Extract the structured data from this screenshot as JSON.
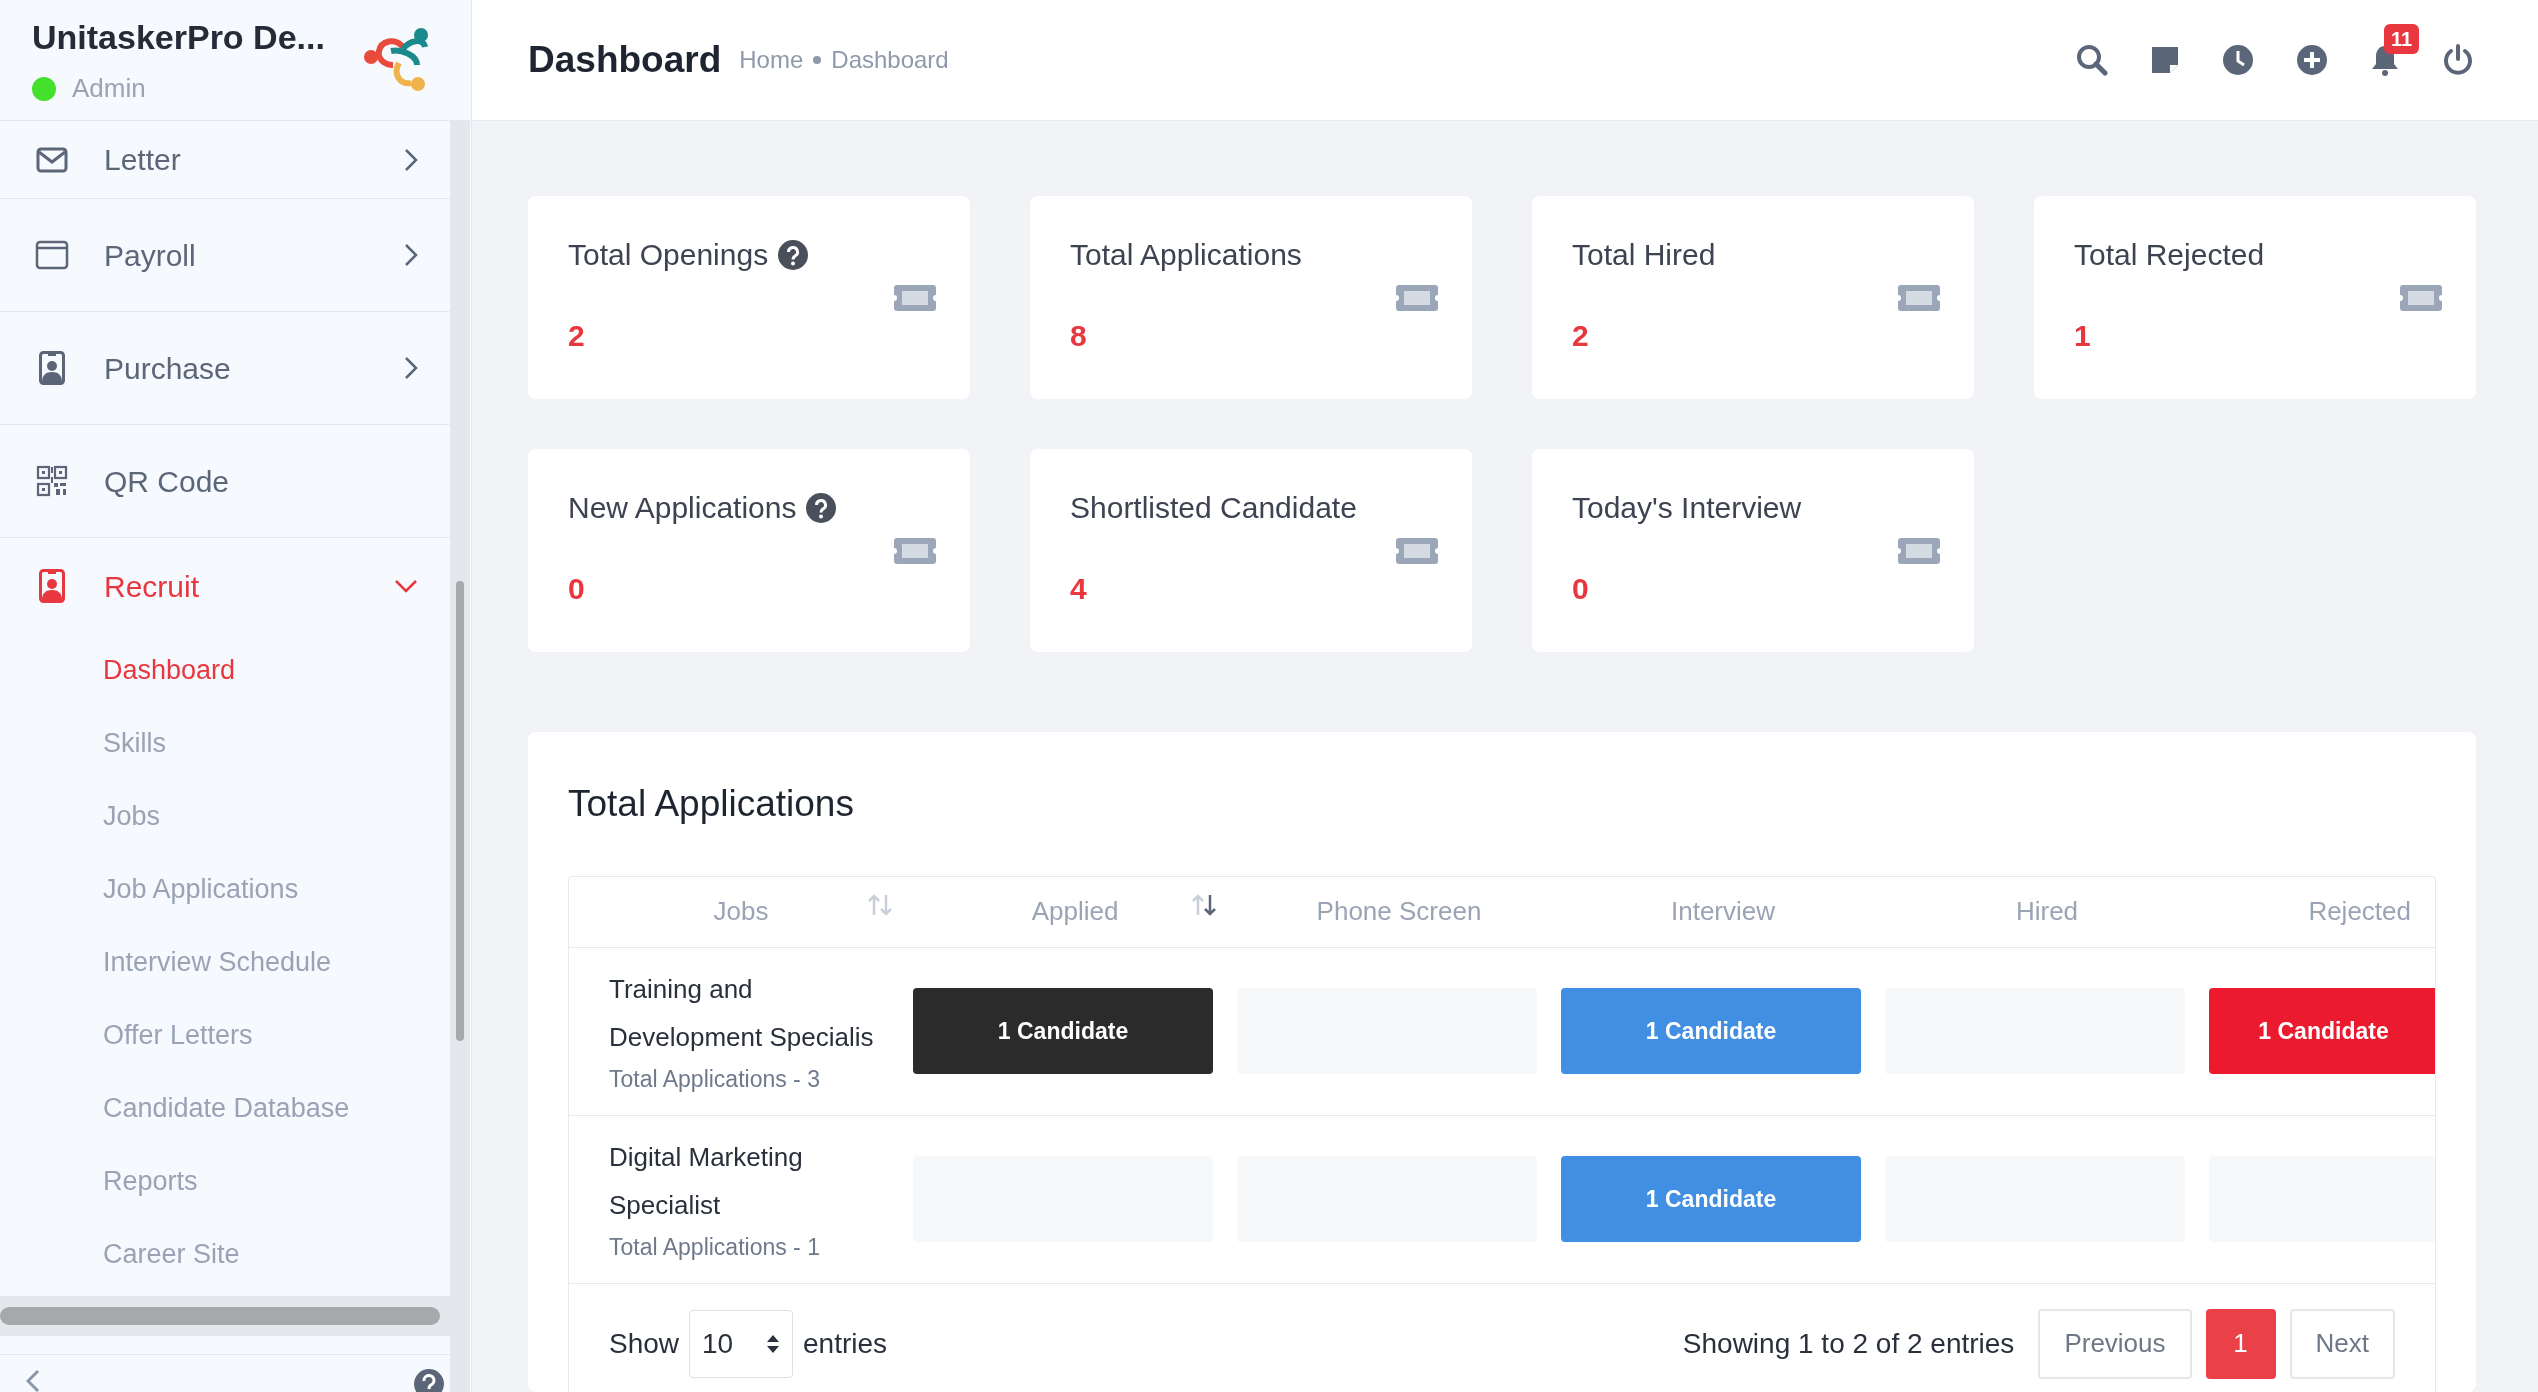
{
  "sidebar": {
    "app_name": "UnitaskerPro De...",
    "role": "Admin",
    "online": true,
    "menu": [
      {
        "label": "Letter",
        "has_arrow": true,
        "expanded": false,
        "selected": false
      },
      {
        "label": "Payroll",
        "has_arrow": true,
        "expanded": false,
        "selected": false
      },
      {
        "label": "Purchase",
        "has_arrow": true,
        "expanded": false,
        "selected": false
      },
      {
        "label": "QR Code",
        "has_arrow": false,
        "selected": false
      },
      {
        "label": "Recruit",
        "has_arrow": true,
        "expanded": true,
        "selected": true,
        "children": [
          {
            "label": "Dashboard",
            "selected": true
          },
          {
            "label": "Skills",
            "selected": false
          },
          {
            "label": "Jobs",
            "selected": false
          },
          {
            "label": "Job Applications",
            "selected": false
          },
          {
            "label": "Interview Schedule",
            "selected": false
          },
          {
            "label": "Offer Letters",
            "selected": false
          },
          {
            "label": "Candidate Database",
            "selected": false
          },
          {
            "label": "Reports",
            "selected": false
          },
          {
            "label": "Career Site",
            "selected": false
          }
        ]
      }
    ]
  },
  "header": {
    "title": "Dashboard",
    "breadcrumb": [
      "Home",
      "Dashboard"
    ],
    "notification_count": "11"
  },
  "stats": [
    {
      "label": "Total Openings",
      "value": "2",
      "help": true
    },
    {
      "label": "Total Applications",
      "value": "8",
      "help": false
    },
    {
      "label": "Total Hired",
      "value": "2",
      "help": false
    },
    {
      "label": "Total Rejected",
      "value": "1",
      "help": false
    },
    {
      "label": "New Applications",
      "value": "0",
      "help": true
    },
    {
      "label": "Shortlisted Candidate",
      "value": "4",
      "help": false
    },
    {
      "label": "Today's Interview",
      "value": "0",
      "help": false
    }
  ],
  "applications": {
    "title": "Total Applications",
    "columns": [
      {
        "label": "Jobs",
        "kind": "job",
        "sort_descending": false
      },
      {
        "label": "Applied",
        "kind": "applied",
        "sort_descending": true
      },
      {
        "label": "Phone Screen",
        "kind": "phone"
      },
      {
        "label": "Interview",
        "kind": "interview"
      },
      {
        "label": "Hired",
        "kind": "hired"
      },
      {
        "label": "Rejected",
        "kind": "rejected"
      }
    ],
    "rows": [
      {
        "job": "Training and Development Specialis",
        "total": "Total Applications - 3",
        "stages": [
          {
            "kind": "candidates",
            "label": "1 Candidate"
          },
          {
            "kind": "empty"
          },
          {
            "kind": "candidates",
            "label": "1 Candidate"
          },
          {
            "kind": "empty"
          },
          {
            "kind": "candidates",
            "label": "1 Candidate"
          }
        ]
      },
      {
        "job": "Digital Marketing Specialist",
        "total": "Total Applications - 1",
        "stages": [
          {
            "kind": "empty"
          },
          {
            "kind": "empty"
          },
          {
            "kind": "candidates",
            "label": "1 Candidate"
          },
          {
            "kind": "empty"
          },
          {
            "kind": "empty"
          }
        ]
      }
    ],
    "footer": {
      "show_label": "Show",
      "page_size": "10",
      "entries_label": "entries",
      "info": "Showing 1 to 2 of 2 entries",
      "pages": [
        {
          "label": "Previous",
          "selected": false
        },
        {
          "label": "1",
          "selected": true
        },
        {
          "label": "Next",
          "selected": false
        }
      ]
    }
  }
}
